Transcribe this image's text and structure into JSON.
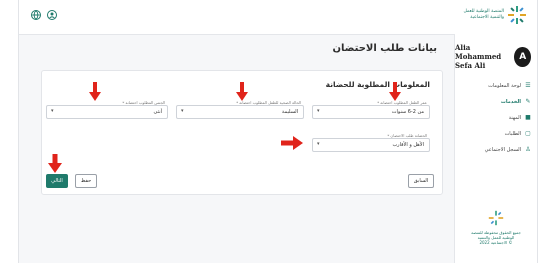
{
  "header": {
    "logo_line1": "المنصة الوطنية للعمل",
    "logo_line2": "والتنمية الاجتماعية",
    "icons": [
      "globe-icon",
      "user-icon"
    ]
  },
  "sidebar": {
    "user_initial": "A",
    "user_name_line1": "Alia Mohammed",
    "user_name_line2": "Sefa Ali",
    "items": [
      {
        "label": "لوحة المعلومات",
        "icon": "dashboard-icon",
        "active": false
      },
      {
        "label": "الخدمات",
        "icon": "services-icon",
        "active": true
      },
      {
        "label": "المهنة",
        "icon": "briefcase-icon",
        "active": false
      },
      {
        "label": "الطلبات",
        "icon": "requests-icon",
        "active": false
      },
      {
        "label": "السجل الاجتماعي",
        "icon": "social-record-icon",
        "active": false
      }
    ],
    "footer_line1": "جميع الحقوق محفوظة للمنصة الوطنية للعمل والتنمية",
    "footer_line2": "الاجتماعية 2022 ©"
  },
  "page": {
    "title": "بيانات طلب الاحتضان"
  },
  "form": {
    "section_title": "المعلومات المطلوبة للحضانة",
    "fields": [
      {
        "label": "عمر الطفل المطلوب احتضانه *",
        "value": "من 2-6 سنوات"
      },
      {
        "label": "الحالة الصحية للطفل المطلوب احتضانه *",
        "value": "السليمة"
      },
      {
        "label": "الجنس المطلوب احتضانه *",
        "value": "أنثى"
      },
      {
        "label": "الحضانة طلب الاحتضان *",
        "value": "الأهل و الأقارب"
      }
    ],
    "buttons": {
      "next": "التالي",
      "save": "حفظ",
      "back": "السابق"
    }
  },
  "colors": {
    "brand": "#1f7a6b",
    "annotation_arrow": "#e0241b"
  }
}
